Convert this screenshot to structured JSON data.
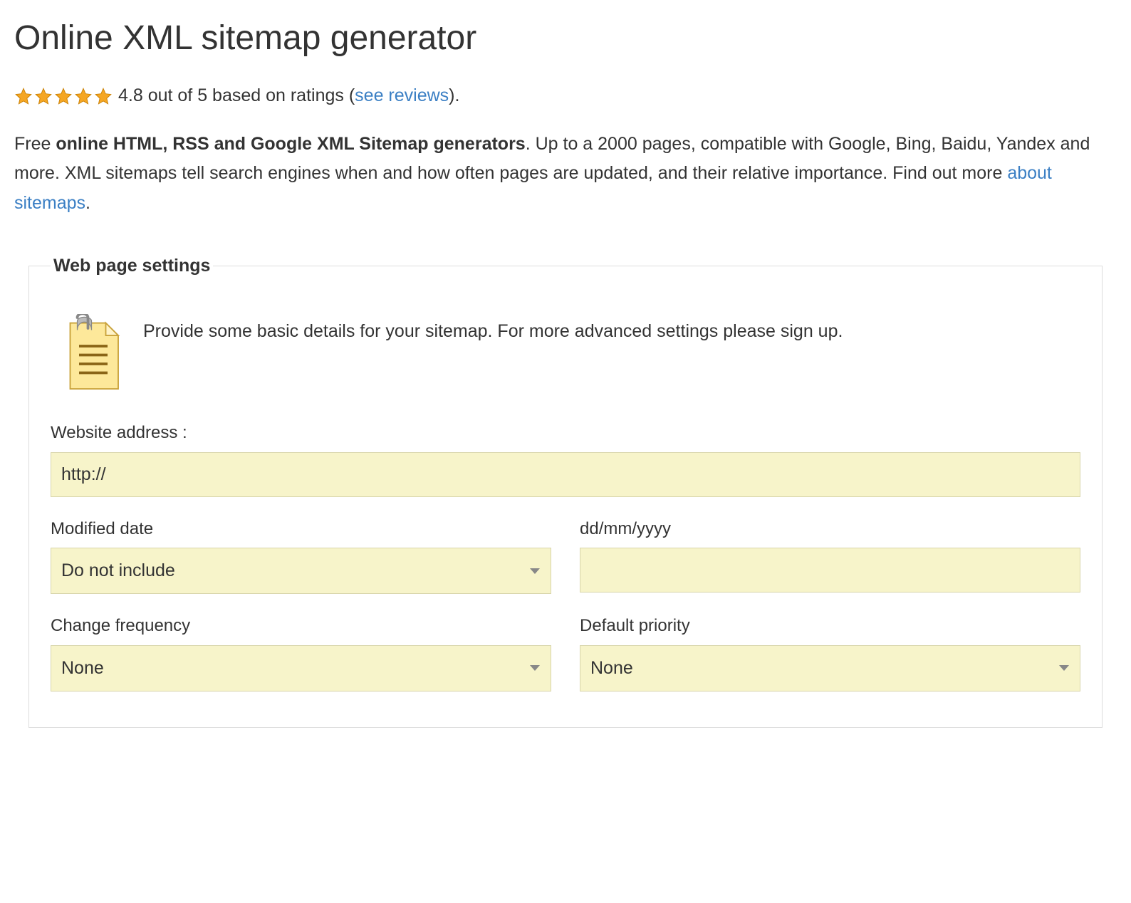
{
  "title": "Online XML sitemap generator",
  "rating": {
    "stars": 5,
    "text": "4.8 out of 5 based on ratings (",
    "link": "see reviews",
    "close": ")."
  },
  "description": {
    "prefix": "Free ",
    "bold": "online HTML, RSS and Google XML Sitemap generators",
    "middle": ". Up to a 2000 pages, compatible with Google, Bing, Baidu, Yandex and more. XML sitemaps tell search engines when and how often pages are updated, and their relative importance. Find out more ",
    "link": "about sitemaps",
    "suffix": "."
  },
  "fieldset": {
    "legend": "Web page settings",
    "intro": "Provide some basic details for your sitemap. For more advanced settings please sign up.",
    "website": {
      "label": "Website address :",
      "value": "http://"
    },
    "modified": {
      "label": "Modified date",
      "selected": "Do not include"
    },
    "dateFormat": {
      "label": "dd/mm/yyyy",
      "value": ""
    },
    "frequency": {
      "label": "Change frequency",
      "selected": "None"
    },
    "priority": {
      "label": "Default priority",
      "selected": "None"
    }
  }
}
